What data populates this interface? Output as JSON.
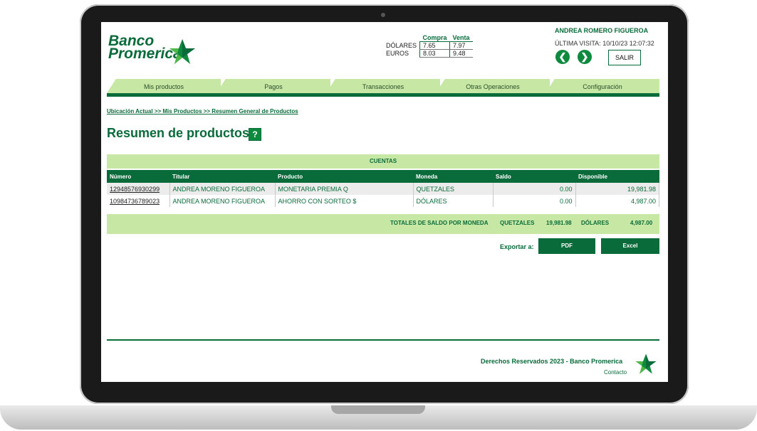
{
  "brand": {
    "line1": "Banco",
    "line2": "Promerica"
  },
  "rates": {
    "headers": [
      "Compra",
      "Venta"
    ],
    "rows": [
      {
        "currency": "DÓLARES",
        "buy": "7.65",
        "sell": "7.97"
      },
      {
        "currency": "EUROS",
        "buy": "8.03",
        "sell": "9.48"
      }
    ]
  },
  "user": {
    "name": "ANDREA ROMERO FIGUEROA",
    "visit_label": "ÚLTIMA VISITA:",
    "visit_value": "10/10/23 12:07:32",
    "logout_label": "SALIR",
    "back_glyph": "❮",
    "forward_glyph": "❯"
  },
  "tabs": [
    "Mis productos",
    "Pagos",
    "Transacciones",
    "Otras Operaciones",
    "Configuración"
  ],
  "breadcrumb": "Ubicación Actual >> Mis Productos >> Resumen General de Productos",
  "page_title": "Resumen de productos",
  "help_glyph": "?",
  "accounts": {
    "section_title": "CUENTAS",
    "columns": [
      "Número",
      "Titular",
      "Producto",
      "Moneda",
      "Saldo",
      "Disponible"
    ],
    "rows": [
      {
        "number": "12948576930299",
        "holder": "ANDREA MORENO FIGUEROA",
        "product": "MONETARIA PREMIA Q",
        "currency": "QUETZALES",
        "balance": "0.00",
        "available": "19,981.98"
      },
      {
        "number": "10984736789023",
        "holder": "ANDREA MORENO FIGUEROA",
        "product": "AHORRO CON SORTEO $",
        "currency": "DÓLARES",
        "balance": "0.00",
        "available": "4,987.00"
      }
    ],
    "totals": {
      "label": "TOTALES DE SALDO POR MONEDA",
      "q_label": "QUETZALES",
      "q_value": "19,981.98",
      "usd_label": "DÓLARES",
      "usd_value": "4,987.00"
    }
  },
  "export": {
    "label": "Exportar a:",
    "pdf": "PDF",
    "excel": "Excel"
  },
  "footer": {
    "copyright": "Derechos Reservados 2023 - Banco Promerica",
    "contact": "Contacto"
  },
  "colors": {
    "primary": "#0a6b3a",
    "light": "#c7e8a4",
    "accent": "#0d8a3d"
  }
}
